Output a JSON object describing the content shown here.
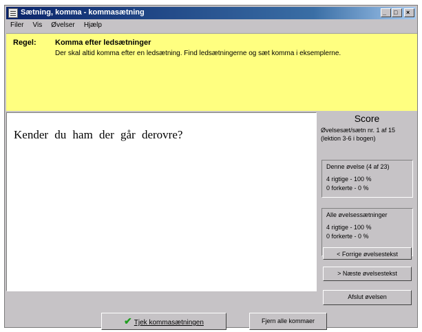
{
  "window": {
    "title": "Sætning, komma - kommasætning"
  },
  "titlebar_buttons": {
    "minimize": "_",
    "maximize": "□",
    "close": "×"
  },
  "menu": [
    "Filer",
    "Vis",
    "Øvelser",
    "Hjælp"
  ],
  "rule": {
    "label": "Regel:",
    "title": "Komma efter ledsætninger",
    "text": "Der skal altid komma efter en ledsætning. Find ledsætningerne og sæt komma i eksemplerne."
  },
  "exercise": {
    "sentence": "Kender du ham der går derovre?"
  },
  "score": {
    "title": "Score",
    "line1": "Øvelsesæt/sætn nr. 1 af 15",
    "line2": "(lektion 3-6 i bogen)",
    "current": {
      "heading": "Denne øvelse (4 af 23)",
      "correct": "4 rigtige  -  100 %",
      "wrong": "0 forkerte  -  0 %"
    },
    "all": {
      "heading": "Alle øvelsessætninger",
      "correct": "4 rigtige  -  100 %",
      "wrong": "0 forkerte  -  0 %"
    }
  },
  "buttons": {
    "previous": "< Forrige øvelsestekst",
    "next": "> Næste øvelsestekst",
    "end": "Afslut øvelsen",
    "check": "Tjek kommasætningen",
    "remove": "Fjern alle kommaer"
  }
}
